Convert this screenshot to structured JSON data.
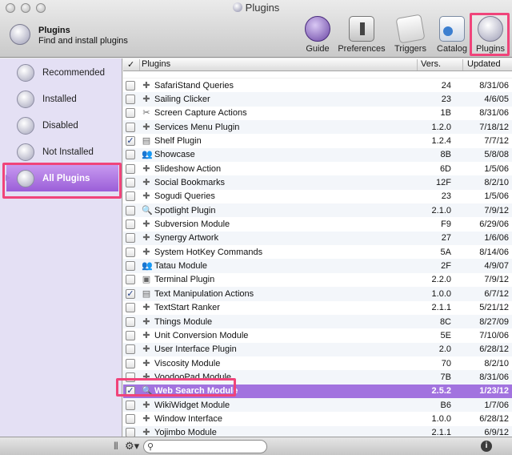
{
  "window": {
    "title": "Plugins"
  },
  "header": {
    "title": "Plugins",
    "subtitle": "Find and install plugins"
  },
  "toolbar": {
    "guide": "Guide",
    "preferences": "Preferences",
    "triggers": "Triggers",
    "catalog": "Catalog",
    "plugins": "Plugins"
  },
  "sidebar": {
    "items": [
      {
        "label": "Recommended"
      },
      {
        "label": "Installed"
      },
      {
        "label": "Disabled"
      },
      {
        "label": "Not Installed"
      },
      {
        "label": "All Plugins"
      }
    ]
  },
  "table": {
    "headers": {
      "check": "✓",
      "name": "Plugins",
      "version": "Vers.",
      "updated": "Updated"
    },
    "rows": [
      {
        "name": "SafariStand Queries",
        "version": "24",
        "updated": "8/31/06",
        "checked": false,
        "icon": "puzzle-icon"
      },
      {
        "name": "Sailing Clicker",
        "version": "23",
        "updated": "4/6/05",
        "checked": false,
        "icon": "puzzle-icon"
      },
      {
        "name": "Screen Capture Actions",
        "version": "1B",
        "updated": "8/31/06",
        "checked": false,
        "icon": "scissors-icon"
      },
      {
        "name": "Services Menu Plugin",
        "version": "1.2.0",
        "updated": "7/18/12",
        "checked": false,
        "icon": "puzzle-icon"
      },
      {
        "name": "Shelf Plugin",
        "version": "1.2.4",
        "updated": "7/7/12",
        "checked": true,
        "icon": "shelf-icon"
      },
      {
        "name": "Showcase",
        "version": "8B",
        "updated": "5/8/08",
        "checked": false,
        "icon": "people-icon"
      },
      {
        "name": "Slideshow Action",
        "version": "6D",
        "updated": "1/5/06",
        "checked": false,
        "icon": "puzzle-icon"
      },
      {
        "name": "Social Bookmarks",
        "version": "12F",
        "updated": "8/2/10",
        "checked": false,
        "icon": "puzzle-icon"
      },
      {
        "name": "Sogudi Queries",
        "version": "23",
        "updated": "1/5/06",
        "checked": false,
        "icon": "puzzle-icon"
      },
      {
        "name": "Spotlight Plugin",
        "version": "2.1.0",
        "updated": "7/9/12",
        "checked": false,
        "icon": "magnifier-icon"
      },
      {
        "name": "Subversion Module",
        "version": "F9",
        "updated": "6/29/06",
        "checked": false,
        "icon": "puzzle-icon"
      },
      {
        "name": "Synergy Artwork",
        "version": "27",
        "updated": "1/6/06",
        "checked": false,
        "icon": "puzzle-icon"
      },
      {
        "name": "System HotKey Commands",
        "version": "5A",
        "updated": "8/14/06",
        "checked": false,
        "icon": "puzzle-icon"
      },
      {
        "name": "Tatau Module",
        "version": "2F",
        "updated": "4/9/07",
        "checked": false,
        "icon": "people-icon"
      },
      {
        "name": "Terminal Plugin",
        "version": "2.2.0",
        "updated": "7/9/12",
        "checked": false,
        "icon": "terminal-icon"
      },
      {
        "name": "Text Manipulation Actions",
        "version": "1.0.0",
        "updated": "6/7/12",
        "checked": true,
        "icon": "document-icon"
      },
      {
        "name": "TextStart Ranker",
        "version": "2.1.1",
        "updated": "5/21/12",
        "checked": false,
        "icon": "puzzle-icon"
      },
      {
        "name": "Things Module",
        "version": "8C",
        "updated": "8/27/09",
        "checked": false,
        "icon": "puzzle-icon"
      },
      {
        "name": "Unit Conversion Module",
        "version": "5E",
        "updated": "7/10/06",
        "checked": false,
        "icon": "puzzle-icon"
      },
      {
        "name": "User Interface Plugin",
        "version": "2.0",
        "updated": "6/28/12",
        "checked": false,
        "icon": "puzzle-icon"
      },
      {
        "name": "Viscosity Module",
        "version": "70",
        "updated": "8/2/10",
        "checked": false,
        "icon": "puzzle-icon"
      },
      {
        "name": "VoodooPad Module",
        "version": "7B",
        "updated": "8/31/06",
        "checked": false,
        "icon": "puzzle-icon"
      },
      {
        "name": "Web Search Module",
        "version": "2.5.2",
        "updated": "1/23/12",
        "checked": true,
        "icon": "magnifier-icon",
        "selected": true
      },
      {
        "name": "WikiWidget Module",
        "version": "B6",
        "updated": "1/7/06",
        "checked": false,
        "icon": "puzzle-icon"
      },
      {
        "name": "Window Interface",
        "version": "1.0.0",
        "updated": "6/28/12",
        "checked": false,
        "icon": "puzzle-icon"
      },
      {
        "name": "Yojimbo Module",
        "version": "2.1.1",
        "updated": "6/9/12",
        "checked": false,
        "icon": "puzzle-icon"
      }
    ]
  },
  "bottombar": {
    "search_value": ""
  },
  "colors": {
    "selection": "#a273df",
    "highlight": "#f0447a",
    "sidebar_bg": "#e4e0f4"
  }
}
